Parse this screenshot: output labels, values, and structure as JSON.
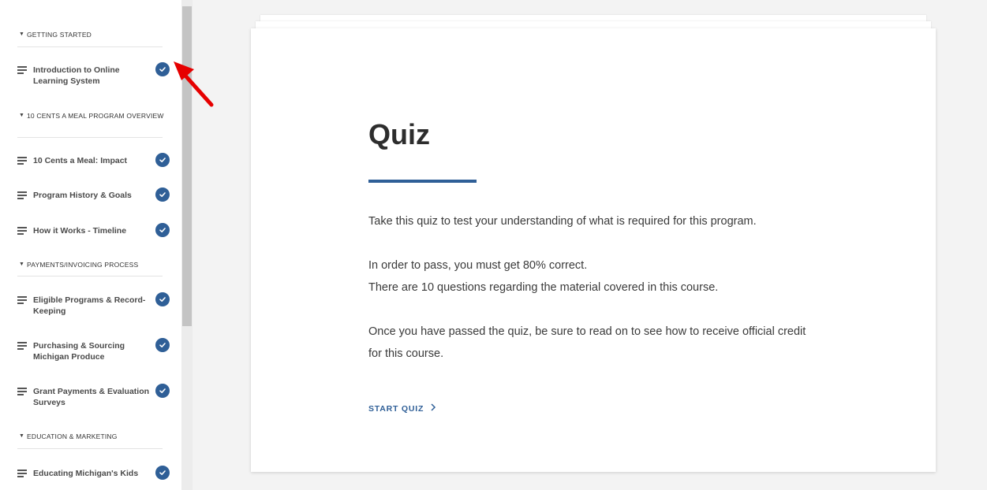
{
  "sidebar": {
    "sections": [
      {
        "title": "GETTING STARTED"
      },
      {
        "title": "10 CENTS A MEAL PROGRAM OVERVIEW"
      },
      {
        "title": "PAYMENTS/INVOICING PROCESS"
      },
      {
        "title": "EDUCATION & MARKETING"
      }
    ],
    "lessons": [
      {
        "label": "Introduction to Online Learning System",
        "completed": true
      },
      {
        "label": "10 Cents a Meal: Impact",
        "completed": true
      },
      {
        "label": "Program History & Goals",
        "completed": true
      },
      {
        "label": "How it Works - Timeline",
        "completed": true
      },
      {
        "label": "Eligible Programs & Record-Keeping",
        "completed": true
      },
      {
        "label": "Purchasing & Sourcing Michigan Produce",
        "completed": true
      },
      {
        "label": "Grant Payments & Evaluation Surveys",
        "completed": true
      },
      {
        "label": "Educating Michigan's Kids",
        "completed": true
      }
    ]
  },
  "main": {
    "title": "Quiz",
    "intro": "Take this quiz to test your understanding of what is required for this program.",
    "pass_line": "In order to pass, you must get 80% correct.",
    "questions_line": "There are 10 questions regarding the material covered in this course.",
    "credit_note": "Once you have passed the quiz, be sure to read on to see how to receive official credit for this course.",
    "start_label": "START QUIZ"
  },
  "colors": {
    "accent": "#2f5f97",
    "annotation": "#e60000"
  },
  "icons": {
    "lesson": "lines-menu-icon",
    "completed": "check-circle-icon",
    "section": "caret-down-icon",
    "start": "chevron-right-icon"
  }
}
